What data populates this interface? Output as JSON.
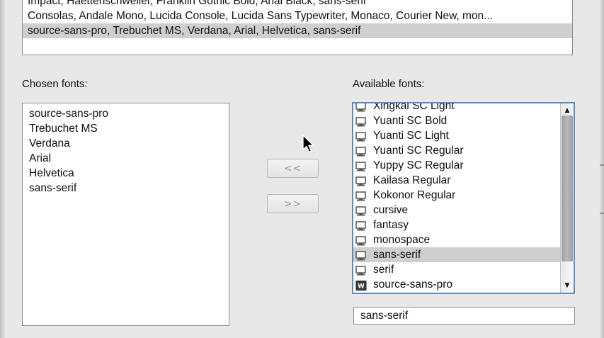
{
  "font_stacks": {
    "items": [
      "Impact, Haettenschweiler, Franklin Gothic Bold, Arial Black, sans-serif",
      "Consolas, Andale Mono, Lucida Console, Lucida Sans Typewriter, Monaco, Courier New, mon...",
      "source-sans-pro, Trebuchet MS, Verdana, Arial, Helvetica, sans-serif"
    ]
  },
  "chosen": {
    "label": "Chosen fonts:",
    "items": [
      "source-sans-pro",
      "Trebuchet MS",
      "Verdana",
      "Arial",
      "Helvetica",
      "sans-serif"
    ]
  },
  "buttons": {
    "add_label": "<<",
    "remove_label": ">>"
  },
  "available": {
    "label": "Available fonts:",
    "items": [
      {
        "name": "Xingkai SC Light",
        "icon": "system-font-icon"
      },
      {
        "name": "Yuanti SC Bold",
        "icon": "system-font-icon"
      },
      {
        "name": "Yuanti SC Light",
        "icon": "system-font-icon"
      },
      {
        "name": "Yuanti SC Regular",
        "icon": "system-font-icon"
      },
      {
        "name": "Yuppy SC Regular",
        "icon": "system-font-icon"
      },
      {
        "name": "Kailasa Regular",
        "icon": "system-font-icon"
      },
      {
        "name": "Kokonor Regular",
        "icon": "system-font-icon"
      },
      {
        "name": "cursive",
        "icon": "system-font-icon"
      },
      {
        "name": "fantasy",
        "icon": "system-font-icon"
      },
      {
        "name": "monospace",
        "icon": "system-font-icon"
      },
      {
        "name": "sans-serif",
        "icon": "system-font-icon"
      },
      {
        "name": "serif",
        "icon": "system-font-icon"
      },
      {
        "name": "source-sans-pro",
        "icon": "web-font-icon"
      }
    ],
    "selected": "sans-serif"
  },
  "font_input": {
    "value": "sans-serif"
  },
  "colors": {
    "selection": "#cfcfcf",
    "focus_ring": "#5b8bc7"
  }
}
